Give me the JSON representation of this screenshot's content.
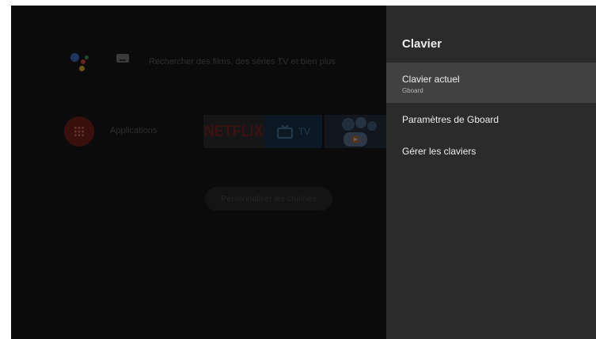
{
  "launcher": {
    "search_placeholder": "Rechercher des films, des séries TV et bien plus",
    "apps_label": "Applications",
    "netflix_label": "NETFLIX",
    "tv_label": "TV",
    "customize_channels": "Personnaliser les chaînes"
  },
  "panel": {
    "title": "Clavier",
    "items": [
      {
        "label": "Clavier actuel",
        "sublabel": "Gboard"
      },
      {
        "label": "Paramètres de Gboard"
      },
      {
        "label": "Gérer les claviers"
      }
    ]
  },
  "colors": {
    "panel_bg": "#2b2b2b",
    "selected_item_bg": "#414141",
    "screen_bg": "#0b0b0b"
  }
}
